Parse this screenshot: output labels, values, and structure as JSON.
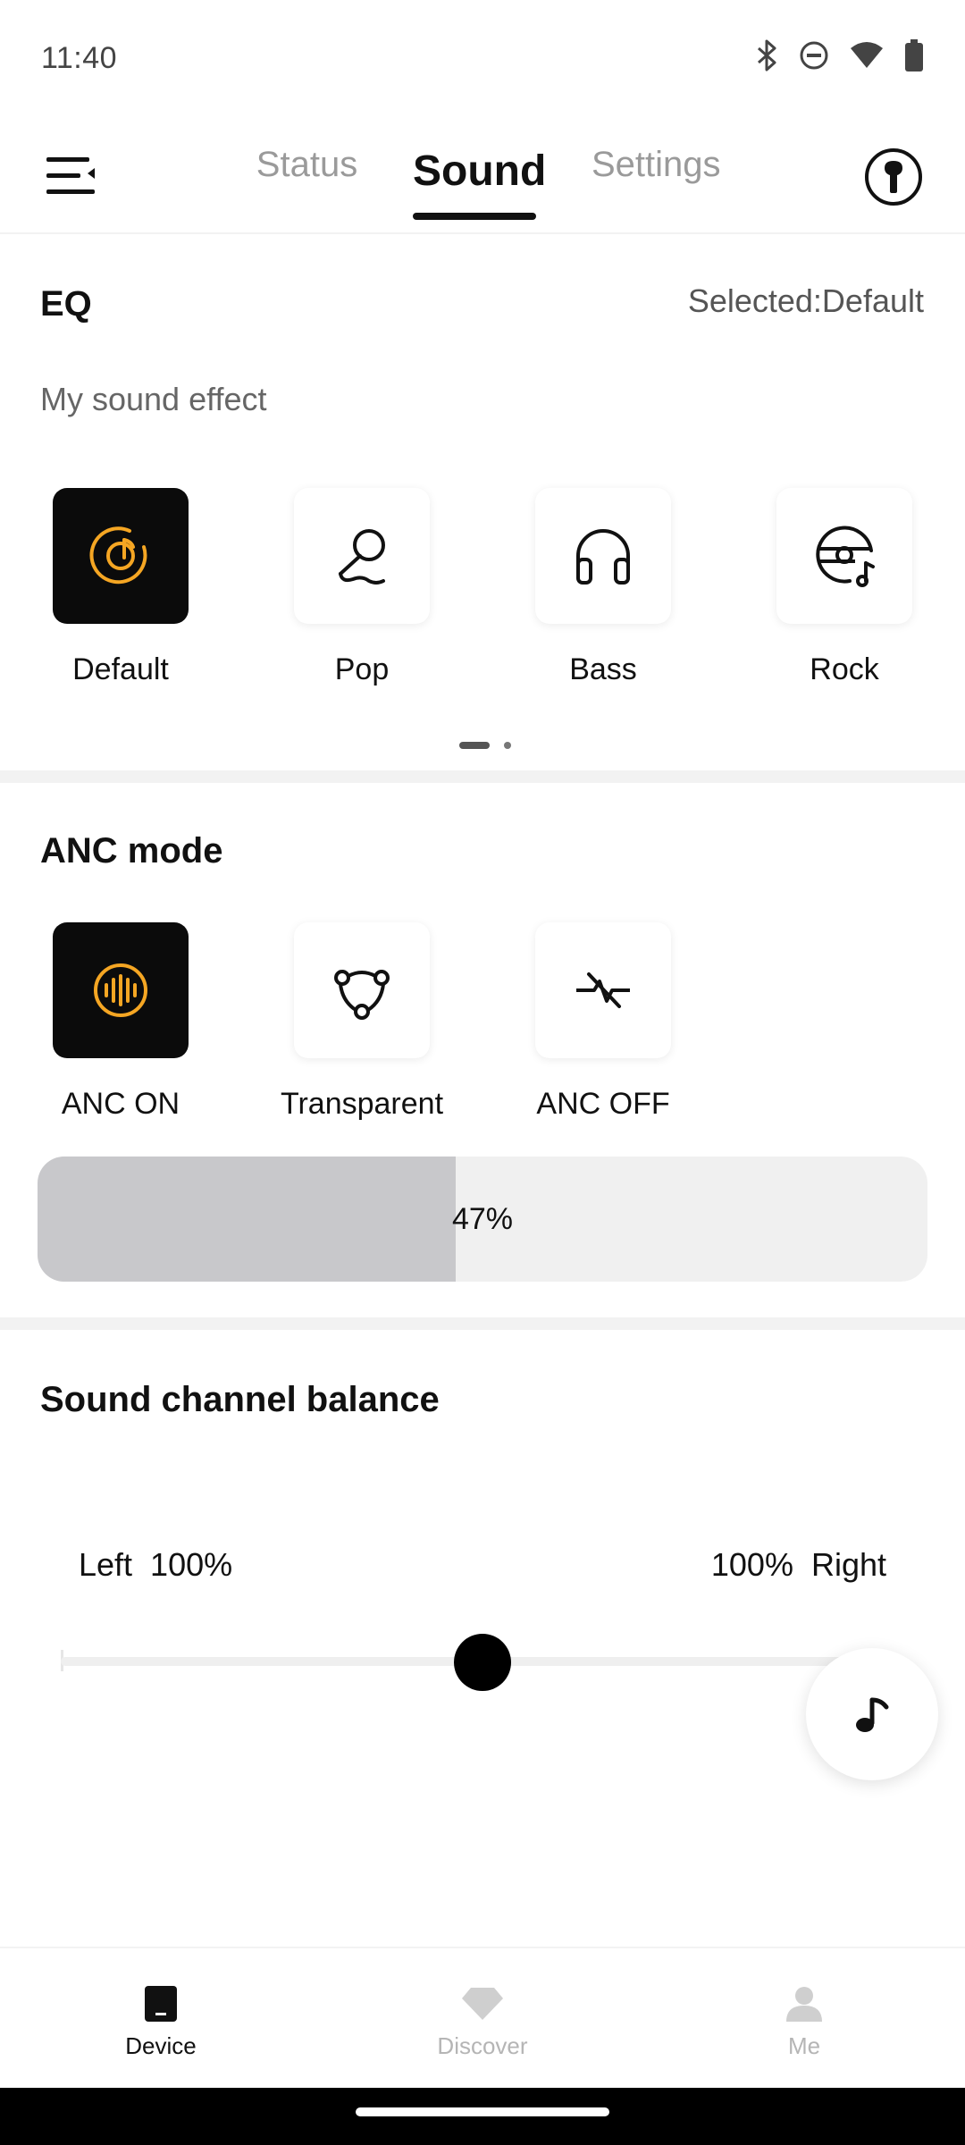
{
  "status_bar": {
    "time": "11:40",
    "icons": [
      "bluetooth-icon",
      "do-not-disturb-icon",
      "wifi-icon",
      "battery-icon"
    ]
  },
  "top_nav": {
    "tabs": [
      {
        "label": "Status",
        "active": false
      },
      {
        "label": "Sound",
        "active": true
      },
      {
        "label": "Settings",
        "active": false
      }
    ]
  },
  "eq": {
    "title": "EQ",
    "selected_text": "Selected:Default",
    "subtitle": "My sound effect",
    "presets": [
      {
        "label": "Default",
        "icon": "disc-note-icon",
        "selected": true
      },
      {
        "label": "Pop",
        "icon": "microphone-icon",
        "selected": false
      },
      {
        "label": "Bass",
        "icon": "headphones-icon",
        "selected": false
      },
      {
        "label": "Rock",
        "icon": "vinyl-note-icon",
        "selected": false
      }
    ],
    "page_count": 2,
    "active_page": 1
  },
  "anc": {
    "title": "ANC mode",
    "modes": [
      {
        "label": "ANC ON",
        "icon": "soundwave-icon",
        "selected": true
      },
      {
        "label": "Transparent",
        "icon": "transparency-icon",
        "selected": false
      },
      {
        "label": "ANC OFF",
        "icon": "anc-off-icon",
        "selected": false
      }
    ],
    "level_text": "47%",
    "level_fraction": 0.47
  },
  "balance": {
    "title": "Sound channel balance",
    "left_label": "Left  100%",
    "right_label": "100%  Right",
    "position_fraction": 0.5
  },
  "bottom_nav": {
    "items": [
      {
        "label": "Device",
        "icon": "device-icon",
        "active": true
      },
      {
        "label": "Discover",
        "icon": "diamond-icon",
        "active": false
      },
      {
        "label": "Me",
        "icon": "person-icon",
        "active": false
      }
    ]
  },
  "colors": {
    "accent": "#F5A623",
    "selected_tile": "#0B0B0B",
    "progress_fill": "#C8C8CB",
    "progress_track": "#F0F0F0"
  }
}
